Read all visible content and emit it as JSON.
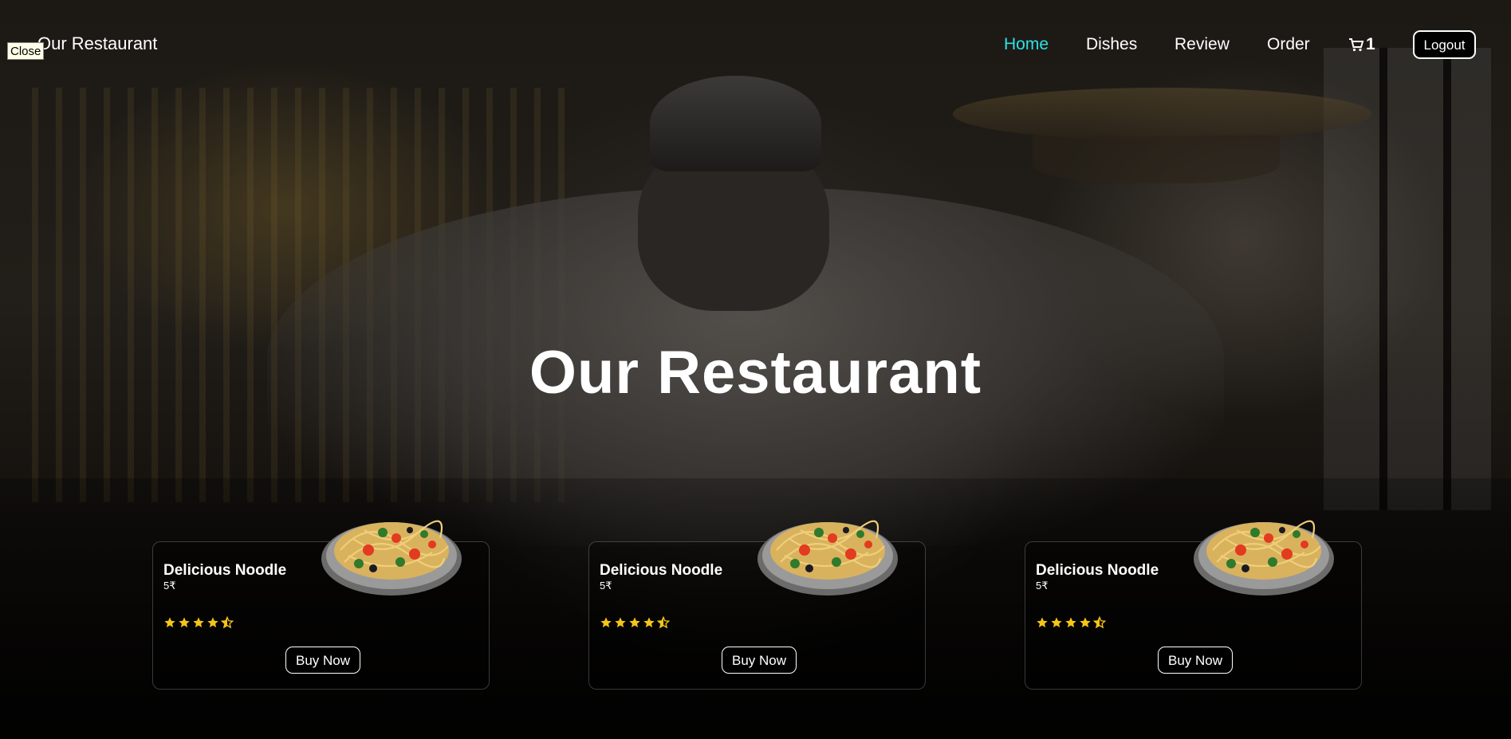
{
  "close_label": "Close",
  "brand": "Our Restaurant",
  "nav": {
    "items": [
      {
        "label": "Home",
        "active": true
      },
      {
        "label": "Dishes",
        "active": false
      },
      {
        "label": "Review",
        "active": false
      },
      {
        "label": "Order",
        "active": false
      }
    ],
    "cart_count": "1",
    "logout_label": "Logout"
  },
  "hero": {
    "title": "Our Restaurant"
  },
  "cards": [
    {
      "title": "Delicious Noodle",
      "price": "5₹",
      "rating": 4.5,
      "button": "Buy Now"
    },
    {
      "title": "Delicious Noodle",
      "price": "5₹",
      "rating": 4.5,
      "button": "Buy Now"
    },
    {
      "title": "Delicious Noodle",
      "price": "5₹",
      "rating": 4.5,
      "button": "Buy Now"
    }
  ],
  "colors": {
    "accent": "#2ee0e6",
    "star": "#f5c518"
  }
}
